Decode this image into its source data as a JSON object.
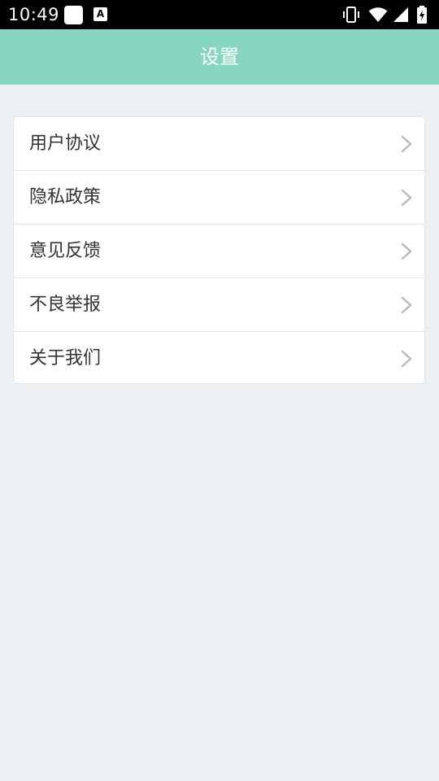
{
  "status_bar": {
    "time": "10:49",
    "notif_icons": [
      "app-notification-icon",
      "font-a-icon"
    ],
    "notif_a_glyph": "A",
    "right_icons": [
      "vibrate-icon",
      "wifi-icon",
      "cell-signal-icon",
      "battery-charging-icon"
    ]
  },
  "header": {
    "title": "设置",
    "background": "#86D6C0"
  },
  "settings": {
    "items": [
      {
        "label": "用户协议",
        "icon": "chevron-right-icon"
      },
      {
        "label": "隐私政策",
        "icon": "chevron-right-icon"
      },
      {
        "label": "意见反馈",
        "icon": "chevron-right-icon"
      },
      {
        "label": "不良举报",
        "icon": "chevron-right-icon"
      },
      {
        "label": "关于我们",
        "icon": "chevron-right-icon"
      }
    ]
  },
  "colors": {
    "page_background": "#ECF0F3",
    "card_background": "#FFFFFF",
    "text": "#333333",
    "chevron": "#BBBBBB"
  }
}
